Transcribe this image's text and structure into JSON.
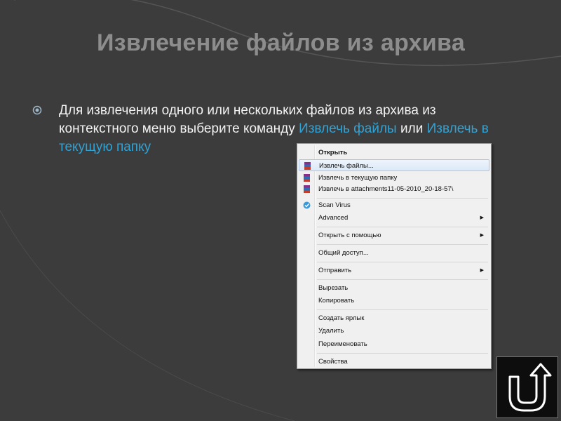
{
  "slide": {
    "title": "Извлечение файлов из архива",
    "text_part1": "Для извлечения одного или нескольких файлов из архива из контекстного меню выберите команду ",
    "highlight1": "Извлечь файлы",
    "text_part2": " или ",
    "highlight2": "Извлечь в текущую папку"
  },
  "context_menu": {
    "items": [
      {
        "label": "Открыть",
        "icon": "none"
      },
      {
        "label": "Извлечь файлы...",
        "icon": "winrar-icon"
      },
      {
        "label": "Извлечь в текущую папку",
        "icon": "winrar-icon"
      },
      {
        "label": "Извлечь в attachments11-05-2010_20-18-57\\",
        "icon": "winrar-icon"
      },
      {
        "label": "Scan Virus",
        "icon": "antivirus-icon"
      },
      {
        "label": "Advanced",
        "icon": "none",
        "submenu": "▶"
      },
      {
        "label": "Открыть с помощью",
        "icon": "none",
        "submenu": "▶"
      },
      {
        "label": "Общий доступ...",
        "icon": "none"
      },
      {
        "label": "Отправить",
        "icon": "none",
        "submenu": "▶"
      },
      {
        "label": "Вырезать",
        "icon": "none"
      },
      {
        "label": "Копировать",
        "icon": "none"
      },
      {
        "label": "Создать ярлык",
        "icon": "none"
      },
      {
        "label": "Удалить",
        "icon": "none"
      },
      {
        "label": "Переименовать",
        "icon": "none"
      },
      {
        "label": "Свойства",
        "icon": "none"
      }
    ]
  },
  "colors": {
    "background": "#3c3c3c",
    "title": "#8d8d8d",
    "highlight": "#2fa3d6"
  }
}
